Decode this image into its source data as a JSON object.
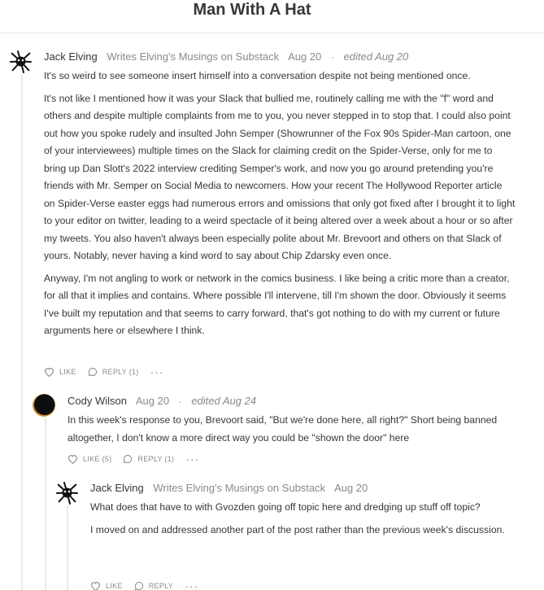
{
  "page": {
    "title": "Man With A Hat"
  },
  "comments": [
    {
      "author": "Jack Elving",
      "publication": "Writes Elving's Musings on Substack",
      "date": "Aug 20",
      "separator": "·",
      "edited": "edited Aug 20",
      "paragraphs": [
        "It's so weird to see someone insert himself into a conversation despite not being mentioned once.",
        "It's not like I mentioned how it was your Slack that bullied me, routinely calling me with the \"f\" word and others and despite multiple complaints from me to you, you never stepped in to stop that. I could also point out how you spoke rudely and insulted John Semper (Showrunner of the Fox 90s Spider-Man cartoon, one of your interviewees) multiple times on the Slack for claiming credit on the Spider-Verse, only for me to bring up Dan Slott's 2022 interview crediting Semper's work, and now you go around pretending you're friends with Mr. Semper on Social Media to newcomers. How your recent The Hollywood Reporter article on Spider-Verse easter eggs had numerous errors and omissions that only got fixed after I brought it to light to your editor on twitter, leading to a weird spectacle of it being altered over a week about a hour or so after my tweets. You also haven't always been especially polite about Mr. Brevoort and others on that Slack of yours. Notably, never having a kind word to say about Chip Zdarsky even once.",
        "Anyway, I'm not angling to work or network in the comics business. I like being a critic more than a creator, for all that it implies and contains. Where possible I'll intervene, till I'm shown the door. Obviously it seems I've built my reputation and that seems to carry forward, that's got nothing to do with my current or future arguments here or elsewhere I think."
      ],
      "like_label": "LIKE",
      "reply_label": "REPLY (1)",
      "more_label": "···"
    },
    {
      "author": "Cody Wilson",
      "date": "Aug 20",
      "separator": "·",
      "edited": "edited Aug 24",
      "paragraphs": [
        "In this week's response to you, Brevoort said, \"But we're done here, all right?\" Short being banned altogether, I don't know a more direct way you could be \"shown the door\" here"
      ],
      "like_label": "LIKE (5)",
      "reply_label": "REPLY (1)",
      "more_label": "···"
    },
    {
      "author": "Jack Elving",
      "publication": "Writes Elving's Musings on Substack",
      "date": "Aug 20",
      "paragraphs": [
        "What does that have to with Gvozden going off topic here and dredging up stuff off topic?",
        "I moved on and addressed another part of the post rather than the previous week's discussion."
      ],
      "like_label": "LIKE",
      "reply_label": "REPLY",
      "more_label": "···"
    }
  ],
  "icons": {
    "like": "heart-icon",
    "reply": "speech-bubble-icon",
    "more": "ellipsis-icon"
  },
  "colors": {
    "text": "#363737",
    "meta": "#8a8a8a",
    "divider": "#e6e6e6"
  }
}
